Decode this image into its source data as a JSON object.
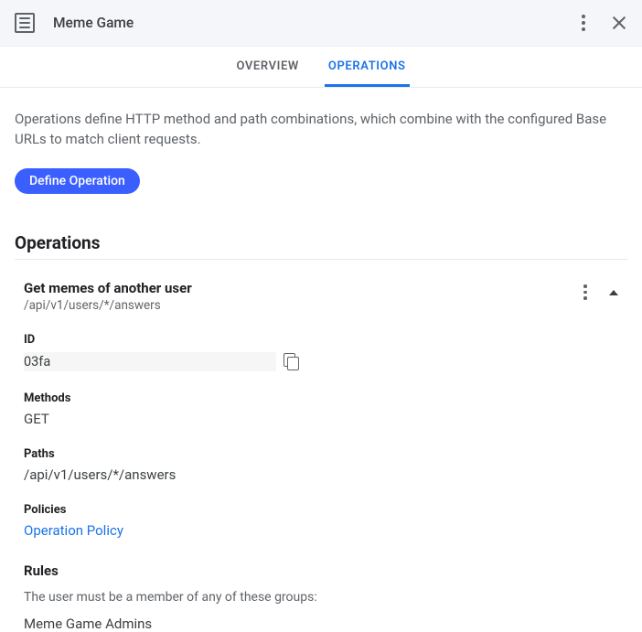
{
  "header": {
    "title": "Meme Game"
  },
  "tabs": {
    "overview": "OVERVIEW",
    "operations": "OPERATIONS"
  },
  "description": "Operations define HTTP method and path combinations, which combine with the configured Base URLs to match client requests.",
  "define_button": "Define Operation",
  "section_title": "Operations",
  "operation": {
    "title": "Get memes of another user",
    "subtitle": "/api/v1/users/*/answers",
    "id_label": "ID",
    "id_value": "03fa",
    "methods_label": "Methods",
    "methods_value": "GET",
    "paths_label": "Paths",
    "paths_value": "/api/v1/users/*/answers",
    "policies_label": "Policies",
    "policies_link": "Operation Policy",
    "rules_title": "Rules",
    "rules_desc": "The user must be a member of any of these groups:",
    "rules_group": "Meme Game Admins"
  }
}
